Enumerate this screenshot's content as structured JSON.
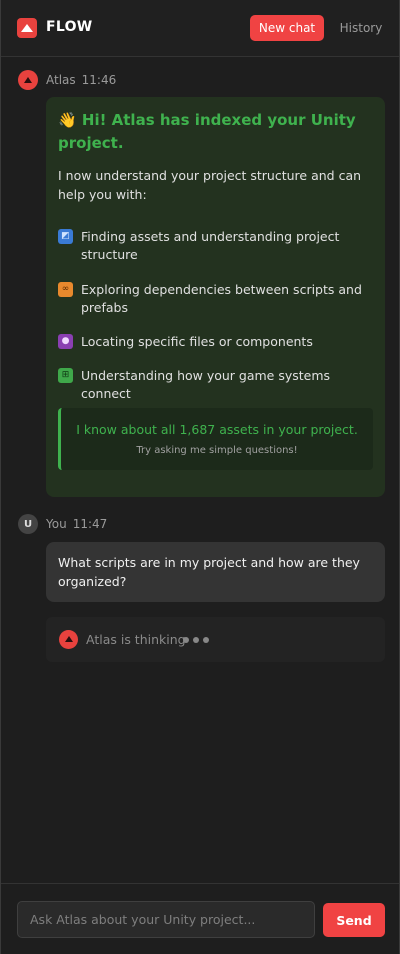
{
  "header": {
    "app_name": "FLOW",
    "new_chat_label": "New chat",
    "history_label": "History"
  },
  "colors": {
    "accent": "#f04343",
    "success_green": "#3fb24e",
    "background": "#1e1e1e"
  },
  "messages": [
    {
      "sender": "Atlas",
      "time": "11:46",
      "avatar_icon": "atlas-logo-icon",
      "title": "👋 Hi! Atlas has indexed your Unity project.",
      "intro": "I now understand your project structure and can help you with:",
      "features": [
        {
          "icon": "folder-icon",
          "glyph": "◩",
          "color": "#3a7bd5",
          "text": "Finding assets and understanding project structure"
        },
        {
          "icon": "link-icon",
          "glyph": "🔗",
          "color": "#e8892d",
          "text": "Exploring dependencies between scripts and prefabs"
        },
        {
          "icon": "magnifier-icon",
          "glyph": "🔍",
          "color": "#8a3fb2",
          "text": "Locating specific files or components"
        },
        {
          "icon": "hierarchy-icon",
          "glyph": "⊞",
          "color": "#3fa84a",
          "text": "Understanding how your game systems connect"
        }
      ],
      "callout_main": "I know about all 1,687 assets in your project.",
      "callout_sub": "Try asking me simple questions!"
    },
    {
      "sender": "You",
      "time": "11:47",
      "avatar_initial": "U",
      "text": "What scripts are in my project and how are they organized?"
    }
  ],
  "thinking": {
    "text": "Atlas is thinking"
  },
  "composer": {
    "placeholder": "Ask Atlas about your Unity project...",
    "send_label": "Send"
  }
}
